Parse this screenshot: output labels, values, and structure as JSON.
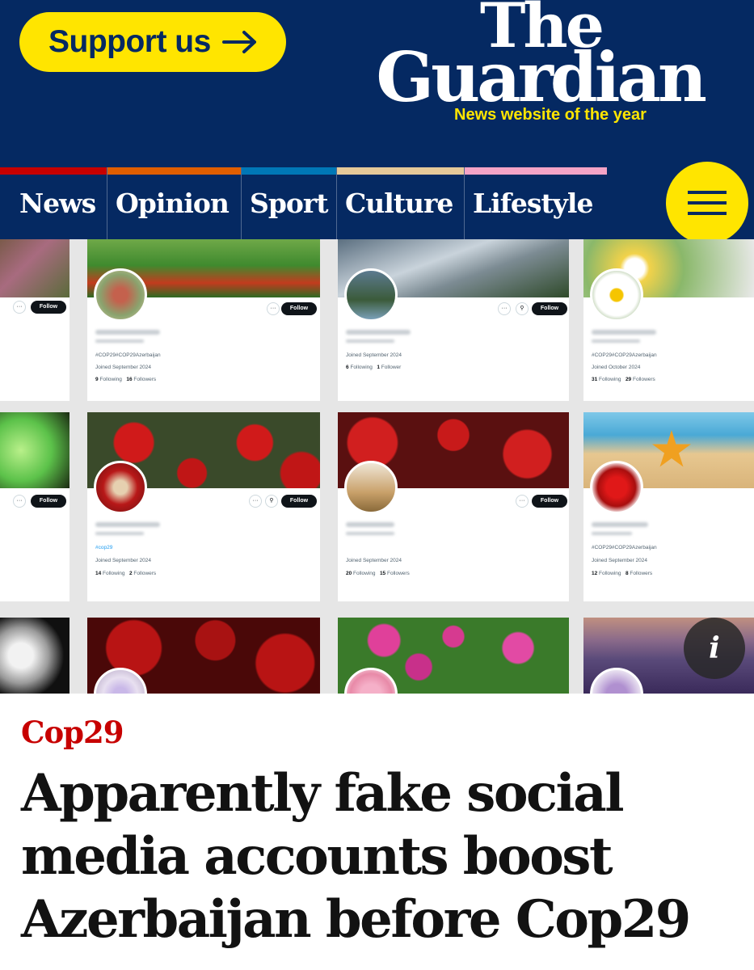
{
  "header": {
    "support_label": "Support us",
    "logo_line1": "The",
    "logo_line2": "Guardian",
    "tagline": "News website of the year",
    "colors": {
      "brand_blue": "#052962",
      "accent_yellow": "#ffe500",
      "kicker_red": "#c70000"
    }
  },
  "nav": {
    "items": [
      {
        "label": "News",
        "color": "#c70000"
      },
      {
        "label": "Opinion",
        "color": "#e05e00"
      },
      {
        "label": "Sport",
        "color": "#0077b6"
      },
      {
        "label": "Culture",
        "color": "#a1845c"
      },
      {
        "label": "Lifestyle",
        "color": "#bb3b80"
      }
    ],
    "menu_icon": "hamburger-menu-icon"
  },
  "hero": {
    "info_icon": "info-icon",
    "info_glyph": "i",
    "cards": [
      {
        "follow": "Follow",
        "bio": "#COP29#COP29Azerbaijan",
        "joined": "Joined September 2024",
        "following": "9",
        "followers": "16"
      },
      {
        "follow": "Follow",
        "bio": "",
        "joined": "Joined September 2024",
        "following": "6",
        "followers": "1"
      },
      {
        "follow": "Follow",
        "bio": "#COP29#COP29Azerbaijan",
        "joined": "Joined October 2024",
        "following": "31",
        "followers": "29"
      },
      {
        "follow": "Follow",
        "bio": "#cop29",
        "joined": "Joined September 2024",
        "following": "14",
        "followers": "2"
      },
      {
        "follow": "Follow",
        "bio": "",
        "joined": "Joined September 2024",
        "following": "20",
        "followers": "15"
      },
      {
        "follow": "Follow",
        "bio": "#COP29#COP29Azerbaijan",
        "joined": "Joined September 2024",
        "following": "12",
        "followers": "8"
      }
    ],
    "following_label": "Following",
    "followers_label": "Followers",
    "single_follower_label": "Follower"
  },
  "article": {
    "kicker": "Cop29",
    "headline": "Apparently fake social media accounts boost Azerbaijan before Cop29"
  }
}
